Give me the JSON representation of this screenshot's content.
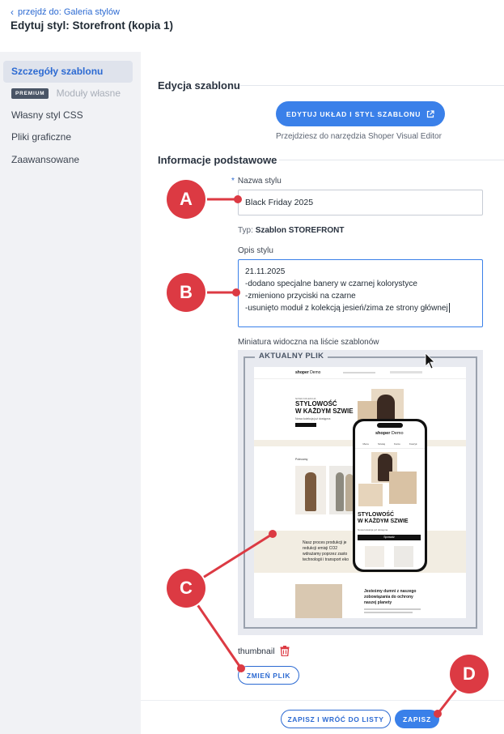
{
  "header": {
    "back_label": "przejdź do: Galeria stylów",
    "title": "Edytuj styl: Storefront (kopia 1)"
  },
  "sidebar": {
    "items": [
      {
        "label": "Szczegóły szablonu",
        "active": true
      },
      {
        "label": "Moduły własne",
        "badge": "PREMIUM",
        "disabled": true
      },
      {
        "label": "Własny styl CSS"
      },
      {
        "label": "Pliki graficzne"
      },
      {
        "label": "Zaawansowane"
      }
    ]
  },
  "edit_section": {
    "title": "Edycja szablonu",
    "button_label": "EDYTUJ UKŁAD I STYL SZABLONU",
    "hint": "Przejdziesz do narzędzia Shoper Visual Editor"
  },
  "info_section": {
    "title": "Informacje podstawowe",
    "name_label": "Nazwa stylu",
    "name_required": "*",
    "name_value": "Black Friday 2025",
    "type_prefix": "Typ:",
    "type_value": "Szablon STOREFRONT",
    "desc_label": "Opis stylu",
    "desc_lines": [
      "21.11.2025",
      "-dodano specjalne banery w czarnej kolorystyce",
      "-zmieniono przyciski na czarne",
      "-usunięto moduł z kolekcją jesień/zima ze strony głównej"
    ],
    "thumb_label": "Miniatura widoczna na liście szablonów",
    "thumb_legend": "AKTUALNY PLIK",
    "file_name": "thumbnail",
    "change_file_label": "ZMIEŃ PLIK"
  },
  "thumbnail_preview": {
    "brand": "shoper",
    "brand_suffix": "Demo",
    "hero_small": "NOWA KOLEKCJA",
    "hero_title_1": "STYLOWOŚĆ",
    "hero_title_2": "W KAŻDYM SZWIE",
    "hero_sub": "Nowa kolekcja już dostępna",
    "hero_btn": "Sprawdź",
    "section_label": "Polecamy",
    "eco_text_1": "Nasz proces produkcji je",
    "eco_text_2": "redukcji emisji CO2",
    "eco_text_3": "wdrażamy poprzez zasto",
    "eco_text_4": "technologii i transport eko",
    "eco_title_1": "Jesteśmy dumni z naszego",
    "eco_title_2": "zobowiązania do ochrony",
    "eco_title_3": "naszej planety",
    "phone_nav": [
      "Menu",
      "Szukaj",
      "Konto",
      "Koszyk"
    ]
  },
  "footer": {
    "save_back_label": "ZAPISZ I WRÓĆ DO LISTY",
    "save_label": "ZAPISZ"
  },
  "markers": [
    "A",
    "B",
    "C",
    "D"
  ],
  "colors": {
    "accent": "#3a80e9",
    "marker": "#dc3a43",
    "sidebar_bg": "#f1f2f5"
  }
}
